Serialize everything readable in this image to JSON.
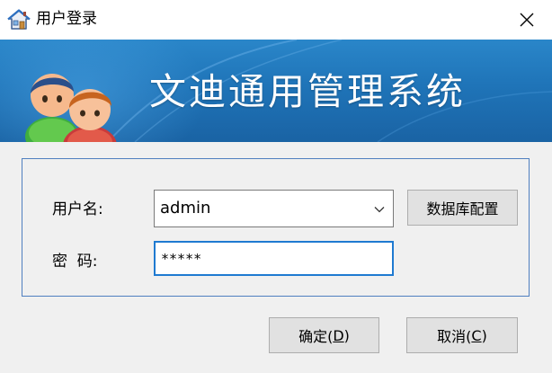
{
  "window": {
    "title": "用户登录",
    "close_glyph": "✕",
    "icon": "house-icon"
  },
  "banner": {
    "title": "文迪通用管理系统",
    "art": "two-users-icon"
  },
  "form": {
    "username_label": "用户名:",
    "username_value": "admin",
    "password_label": "密  码:",
    "password_value": "*****"
  },
  "buttons": {
    "db_config": "数据库配置",
    "ok_prefix": "确定(",
    "ok_key": "D",
    "ok_suffix": ")",
    "cancel_prefix": "取消(",
    "cancel_key": "C",
    "cancel_suffix": ")"
  },
  "colors": {
    "banner_blue": "#1f74b8",
    "group_border": "#4f7fbf",
    "focus_border": "#1f7ad1"
  }
}
